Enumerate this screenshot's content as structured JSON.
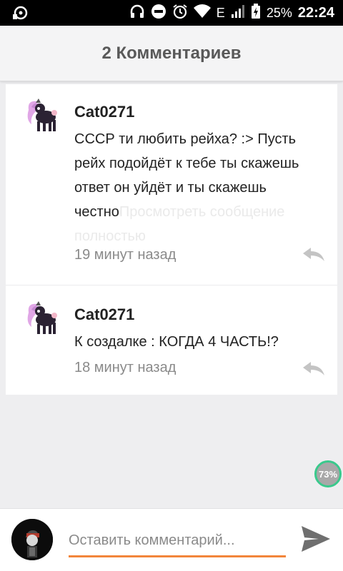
{
  "status_bar": {
    "battery": "25%",
    "time": "22:24",
    "network": "E"
  },
  "header": {
    "title": "2 Комментариев"
  },
  "comments": [
    {
      "author": "Cat0271",
      "text": "СССР ти любить рейха? :> Пусть рейх подойдёт к тебе ты скажешь ответ он уйдёт и ты скажешь честно",
      "more": "Просмотреть сообщение полностью",
      "time": "19 минут назад"
    },
    {
      "author": "Cat0271",
      "text": "К создалке : КОГДА 4 ЧАСТЬ!?",
      "time": "18 минут назад"
    }
  ],
  "progress_badge": "73%",
  "composer": {
    "placeholder": "Оставить комментарий..."
  },
  "colors": {
    "accent": "#f2853a",
    "badge_ring": "#39c98c"
  }
}
